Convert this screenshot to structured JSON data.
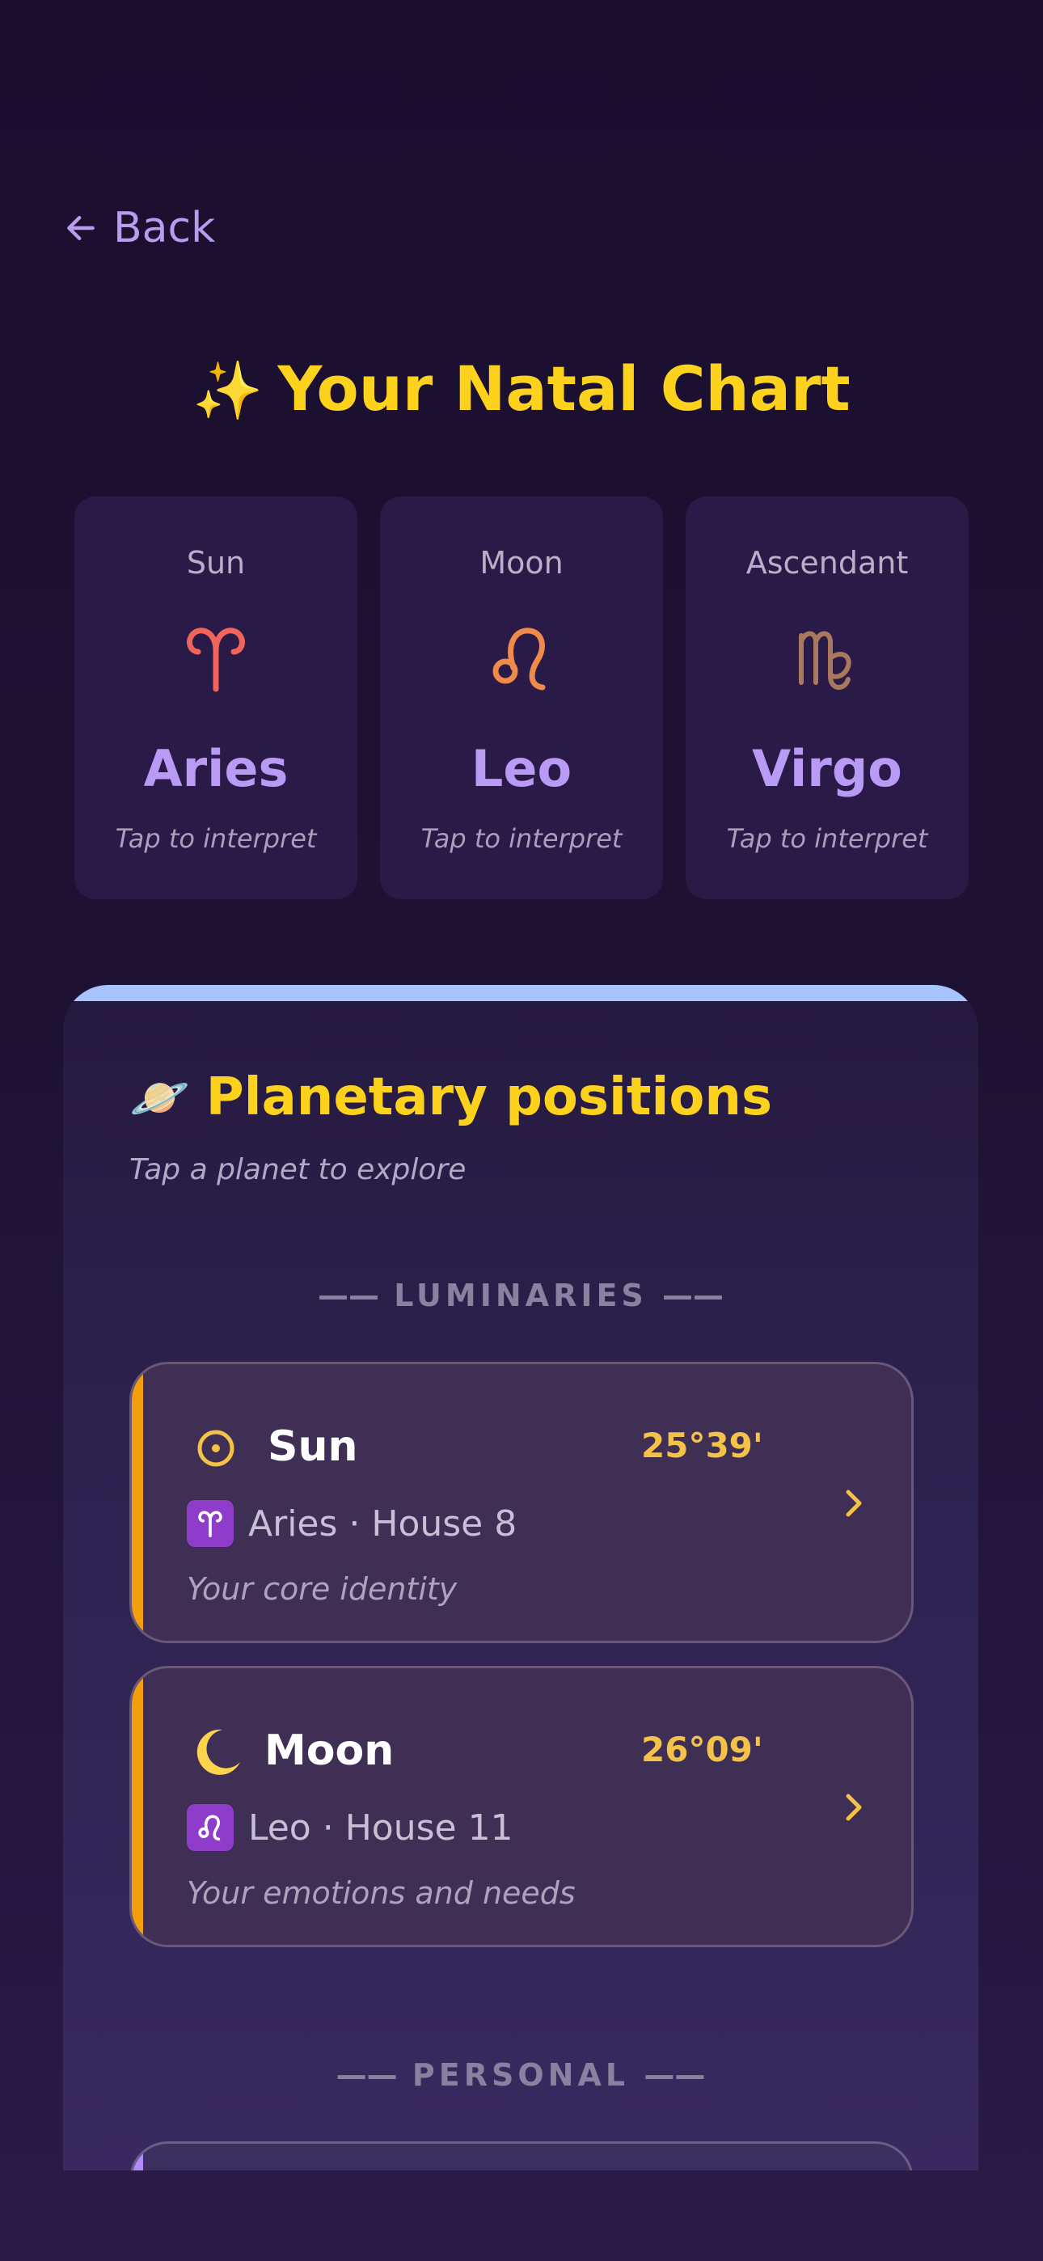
{
  "nav": {
    "back_label": "Back"
  },
  "header": {
    "title": "Your Natal Chart",
    "sparkle_icon": "✨"
  },
  "big_three": [
    {
      "label": "Sun",
      "sign": "Aries",
      "hint": "Tap to interpret",
      "glyph_icon": "aries-glyph-icon",
      "glyph_color": "#f0645c"
    },
    {
      "label": "Moon",
      "sign": "Leo",
      "hint": "Tap to interpret",
      "glyph_icon": "leo-glyph-icon",
      "glyph_color": "#f08a4b"
    },
    {
      "label": "Ascendant",
      "sign": "Virgo",
      "hint": "Tap to interpret",
      "glyph_icon": "virgo-glyph-icon",
      "glyph_color": "#a9795e"
    }
  ],
  "planetary": {
    "icon": "🪐",
    "title": "Planetary positions",
    "subtitle": "Tap a planet to explore",
    "sections": [
      {
        "heading": "LUMINARIES",
        "planets": [
          {
            "name": "Sun",
            "degree": "25°39'",
            "sign_glyph": "♈",
            "sign_text": "Aries · House 8",
            "description": "Your core identity",
            "icon": "sun-symbol-icon"
          },
          {
            "name": "Moon",
            "degree": "26°09'",
            "sign_glyph": "♌",
            "sign_text": "Leo · House 11",
            "description": "Your emotions and needs",
            "icon": "crescent-moon-icon"
          }
        ]
      },
      {
        "heading": "PERSONAL",
        "planets": []
      }
    ]
  },
  "colors": {
    "background": "#1b0e2f",
    "accent_yellow": "#fcd21c",
    "accent_purple": "#b99bf0",
    "luminary_stripe": "#f59e0b",
    "personal_stripe": "#b38af8",
    "panel_top_bar": "#a7c4ff"
  }
}
